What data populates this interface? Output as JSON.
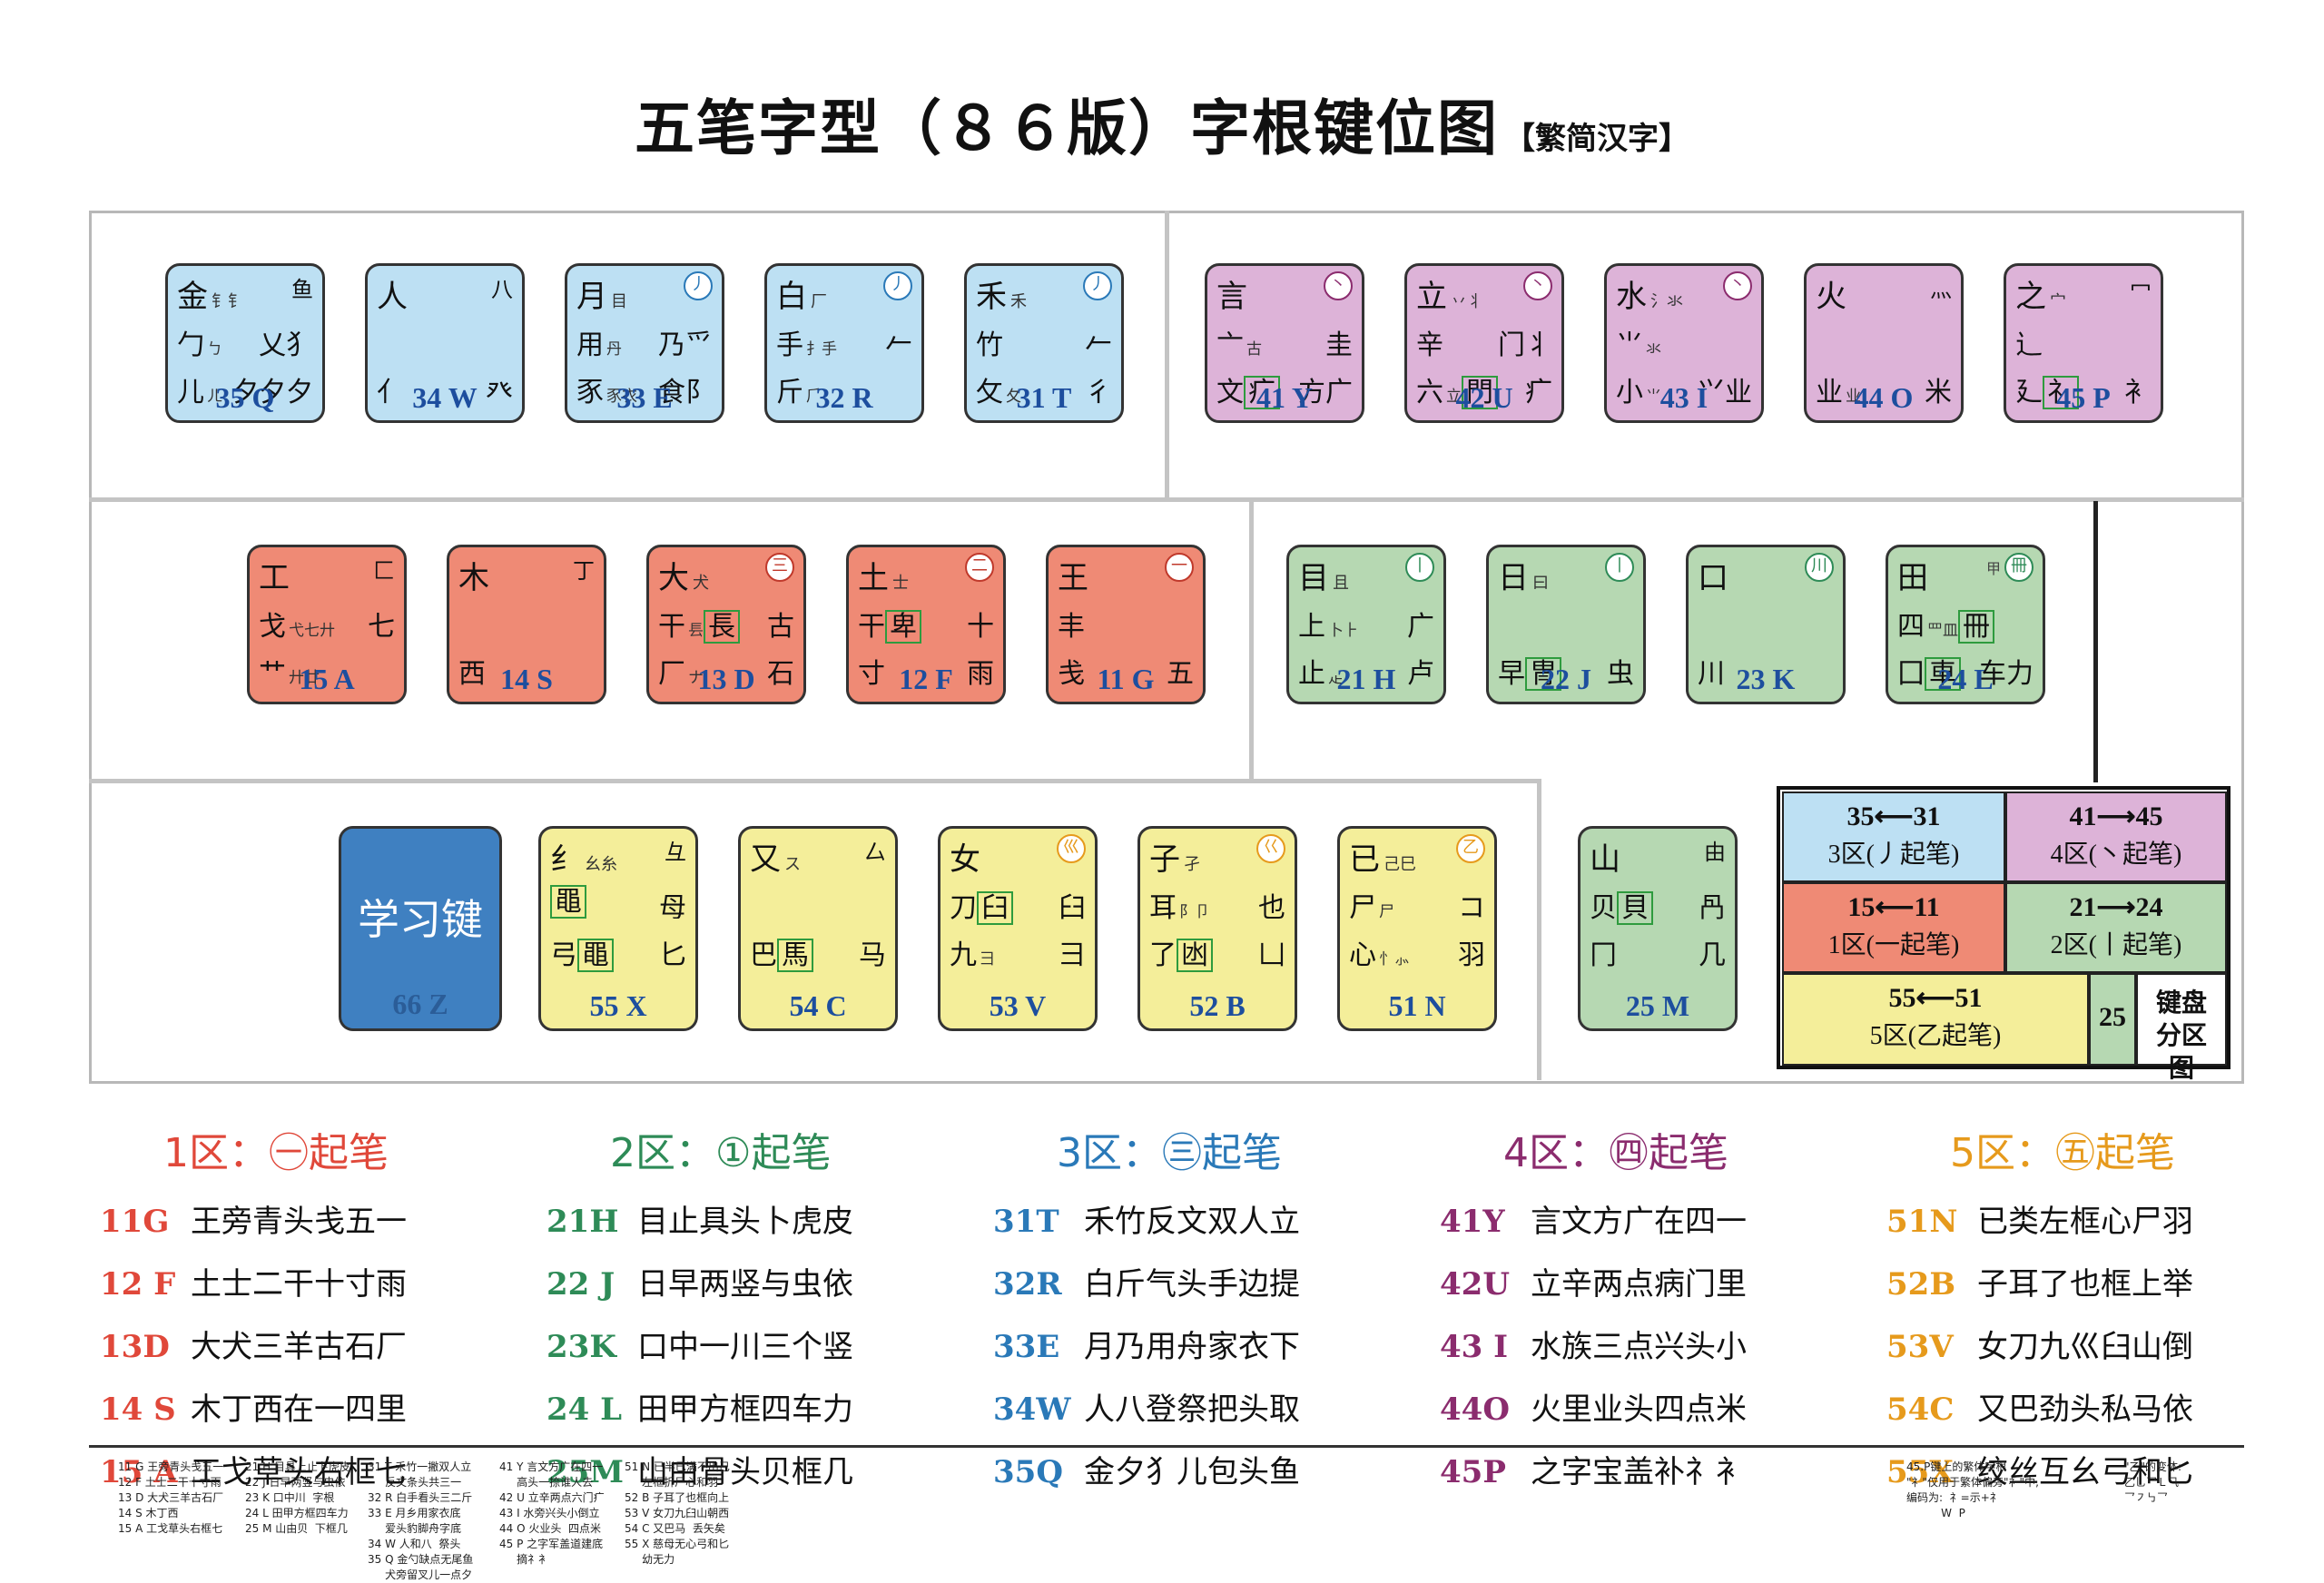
{
  "title": {
    "main": "五笔字型（８６版）字根键位图",
    "sub": "【繁简汉字】"
  },
  "colors": {
    "zone1": "#ef8a75",
    "zone2": "#b6d8b2",
    "zone3": "#bde0f3",
    "zone4": "#ddb3d8",
    "zone5": "#f4ee9a",
    "learn": "#3f80c1"
  },
  "keys": {
    "Q": {
      "tl": "金",
      "tls": "钅钅",
      "tr": "鱼",
      "r2": "勹",
      "r2s": "ㄅ",
      "r2r": "乂犭",
      "r3": "儿",
      "r3s": "ㄦ",
      "r3r": "夕夕夕",
      "code": "35 Q"
    },
    "W": {
      "tl": "人",
      "tr": "八",
      "r2": "",
      "r2r": "癶",
      "r3": "亻",
      "r3r": "癶",
      "code": "34 W"
    },
    "E": {
      "tl": "月",
      "tls": "目",
      "stroke": "丿",
      "r2": "用",
      "r2s": "丹",
      "r2r": "乃爫",
      "r3": "豕",
      "r3s": "豕衣",
      "r3r": "⻝⻖",
      "code": "33 E"
    },
    "R": {
      "tl": "白",
      "tls": "厂",
      "stroke": "丿",
      "r2": "手",
      "r2s": "扌手",
      "r2r": "𠂉",
      "r3": "斤",
      "r3s": "⺁",
      "r3r": "",
      "code": "32 R"
    },
    "T": {
      "tl": "禾",
      "tls": "禾",
      "stroke": "丿",
      "r2": "竹",
      "r2r": "𠂉",
      "r3": "攵",
      "r3s": "夂",
      "r3r": "彳",
      "code": "31 T"
    },
    "Y": {
      "tl": "言",
      "stroke": "丶",
      "r2": "亠",
      "r2s": "古",
      "r2r": "圭",
      "r3": "文",
      "r3b": "疒",
      "r3r": "方广",
      "code": "41 Y"
    },
    "U": {
      "tl": "立",
      "tls": "丷丬",
      "stroke": "丶",
      "r2": "辛",
      "r2r": "门丬",
      "r3": "六",
      "r3s": "立",
      "r3b": "門",
      "r3r": "疒",
      "code": "42 U"
    },
    "I": {
      "tl": "水",
      "tls": "氵氺",
      "stroke": "丶",
      "r2": "⺌",
      "r2s": "氺",
      "r2r": "",
      "r3": "小",
      "r3s": "⺌",
      "r3r": "⺍业",
      "code": "43 I"
    },
    "O": {
      "tl": "火",
      "tr": "灬",
      "r2": "",
      "r2r": "",
      "r3": "业",
      "r3s": "业",
      "r3r": "米",
      "code": "44 O"
    },
    "P": {
      "tl": "之",
      "tls": "宀",
      "tr": "冖",
      "r2": "辶",
      "r2r": "",
      "r3": "廴",
      "r3b": "礻",
      "r3r": "衤",
      "code": "45 P"
    },
    "A": {
      "tl": "工",
      "tr": "匚",
      "r2": "戈",
      "r2s": "弋七廾",
      "r2r": "七",
      "r3": "艹",
      "r3s": "廾廿",
      "r3r": "",
      "code": "15 A"
    },
    "S": {
      "tl": "木",
      "tr": "丁",
      "r2": "",
      "r2r": "",
      "r3": "西",
      "r3r": "",
      "code": "14 S"
    },
    "D": {
      "tl": "大",
      "tls": "犬",
      "stroke": "三",
      "r2": "干",
      "r2s": "镸",
      "r2b": "長",
      "r2r": "古",
      "r3": "厂",
      "r3s": "ナ",
      "r3r": "石",
      "code": "13 D"
    },
    "F": {
      "tl": "土",
      "tls": "士",
      "stroke": "二",
      "r2": "干",
      "r2b": "卑",
      "r2r": "十",
      "r3": "寸",
      "r3r": "雨",
      "code": "12 F"
    },
    "G": {
      "tl": "王",
      "stroke": "一",
      "r2": "丰",
      "r2r": "",
      "r3": "戋",
      "r3r": "五",
      "code": "11 G"
    },
    "H": {
      "tl": "目",
      "tls": "且",
      "stroke": "丨",
      "r2": "上",
      "r2s": "卜⺊",
      "r2r": "广",
      "r3": "止",
      "r3s": "龰",
      "r3r": "卢",
      "code": "21 H"
    },
    "J": {
      "tl": "日",
      "tls": "曰",
      "stroke": "丨",
      "r2": "",
      "r2r": "刂刂",
      "r3": "早",
      "r3b": "冑",
      "r3r": "虫",
      "code": "22 J"
    },
    "K": {
      "tl": "口",
      "stroke": "川",
      "r2": "",
      "r2r": "",
      "r3": "川",
      "r3r": "",
      "code": "23 K"
    },
    "L": {
      "tl": "田",
      "tr": "甲",
      "stroke": "冊",
      "r2": "四",
      "r2s": "罒皿",
      "r2b": "冊",
      "r2r": "",
      "r3": "囗",
      "r3b": "車",
      "r3r": "车力",
      "code": "24 L"
    },
    "M": {
      "tl": "山",
      "tr": "由",
      "r2": "贝",
      "r2b": "貝",
      "r2r": "冎",
      "r3": "冂",
      "r3r": "几",
      "code": "25 M"
    },
    "X": {
      "tl": "纟",
      "tls": "幺糸",
      "tr": "彑",
      "r2": "",
      "r2b": "黽",
      "r2r": "母",
      "r3": "弓",
      "r3b": "黽",
      "r3r": "匕",
      "code": "55 X"
    },
    "C": {
      "tl": "又",
      "tls": "ス",
      "tr": "厶",
      "r2": "",
      "r2r": "",
      "r3": "巴",
      "r3b": "馬",
      "r3r": "马",
      "code": "54 C"
    },
    "V": {
      "tl": "女",
      "stroke": "巛",
      "r2": "刀",
      "r2b": "臼",
      "r2r": "臼",
      "r3": "九",
      "r3s": "彐",
      "r3r": "彐",
      "code": "53 V"
    },
    "B": {
      "tl": "子",
      "tls": "孑",
      "stroke": "巜",
      "r2": "耳",
      "r2s": "阝卩",
      "r2r": "也",
      "r3": "了",
      "r3b": "凼",
      "r3r": "凵",
      "code": "52 B"
    },
    "N": {
      "tl": "已",
      "tls": "己巳",
      "stroke": "乙",
      "r2": "尸",
      "r2s": "尸",
      "r2r": "コ",
      "r3": "心",
      "r3s": "忄⺗",
      "r3r": "羽",
      "code": "51 N"
    }
  },
  "learn_key": {
    "label": "学习键",
    "code": "66 Z"
  },
  "zone_map": {
    "z3": {
      "nums": "35⟵31",
      "note": "3区(丿起笔)"
    },
    "z4": {
      "nums": "41⟶45",
      "note": "4区(丶起笔)"
    },
    "z1": {
      "nums": "15⟵11",
      "note": "1区(一起笔)"
    },
    "z2": {
      "nums": "21⟶24",
      "note": "2区(丨起笔)"
    },
    "z5": {
      "nums": "55⟵51",
      "note": "5区(乙起笔)"
    },
    "z25": "25",
    "label": "键盘分区图"
  },
  "legend": [
    {
      "head": "1区：㊀起笔",
      "color": "#e0483a",
      "rows": [
        [
          "11G",
          "王旁青头戋五一"
        ],
        [
          "12 F",
          "土士二干十寸雨"
        ],
        [
          "13D",
          "大犬三羊古石厂"
        ],
        [
          "14 S",
          "木丁西在一四里"
        ],
        [
          "15 A",
          "工戈草头右框七"
        ]
      ]
    },
    {
      "head": "2区：①起笔",
      "color": "#2e8b57",
      "rows": [
        [
          "21H",
          "目止具头卜虎皮"
        ],
        [
          "22 J",
          "日早两竖与虫依"
        ],
        [
          "23K",
          "口中一川三个竖"
        ],
        [
          "24 L",
          "田甲方框四车力"
        ],
        [
          "25M",
          "山由骨头贝框几"
        ]
      ]
    },
    {
      "head": "3区：㊂起笔",
      "color": "#2a79b8",
      "rows": [
        [
          "31T",
          "禾竹反文双人立"
        ],
        [
          "32R",
          "白斤气头手边提"
        ],
        [
          "33E",
          "月乃用舟家衣下"
        ],
        [
          "34W",
          "人八登祭把头取"
        ],
        [
          "35Q",
          "金夕犭儿包头鱼"
        ]
      ]
    },
    {
      "head": "4区：㊃起笔",
      "color": "#8b2c6e",
      "rows": [
        [
          "41Y",
          "言文方广在四一"
        ],
        [
          "42U",
          "立辛两点病门里"
        ],
        [
          "43 I",
          "水族三点兴头小"
        ],
        [
          "44O",
          "火里业头四点米"
        ],
        [
          "45P",
          "之字宝盖补礻衤"
        ]
      ]
    },
    {
      "head": "5区：㊄起笔",
      "color": "#e69a1c",
      "rows": [
        [
          "51N",
          "已类左框心尸羽"
        ],
        [
          "52B",
          "子耳了也框上举"
        ],
        [
          "53V",
          "女刀九巛臼山倒"
        ],
        [
          "54C",
          "又巴劲头私马依"
        ],
        [
          "55X",
          "绞丝互幺弓和匕"
        ]
      ]
    }
  ],
  "footer": {
    "c1": "11 G 王旁青头戋五一\n12 F 土士二干十寸雨\n13 D 大犬三羊古石厂\n14 S 木丁西\n15 A 工戈草头右框七",
    "c2": "21 H 目具上止卜虎皮\n22 J 日早两竖与虫依\n23 K 口中川  字根\n24 L 田甲方框四车力\n25 M 山由贝  下框几",
    "c3": "31 T 禾竹一撇双人立\n     反文条头共三一\n32 R 白手看头三二斤\n33 E 月乡用家衣底\n     爱头豹脚舟字底\n34 W 人和八  祭头\n35 Q 金勺缺点无尾鱼\n     犬旁留叉儿一点夕",
    "c4": "41 Y 言文方广在四一\n     高头一捺谁人去\n42 U 立辛两点六门疒\n43 I 水旁兴头小倒立\n44 O 火业头  四点米\n45 P 之字军盖道建底\n     摘礻衤",
    "c5": "51 N 已半巳满不出己\n     左框折尸心和羽\n52 B 子耳了也框向上\n53 V 女刀九臼山朝西\n54 C 又巴马  丢矢矣\n55 X 慈母无心弓和匕\n     幼无力",
    "note1": "45.P键上的繁体字根\n\"礻\"仅用于繁体偏旁\"礻\"中,\n编码为:  礻=示+礻\n          W  P",
    "note2": "\"乙\"的变体:\n乙乚乛Ｌ⺄\n乛㇇㇉乛"
  }
}
